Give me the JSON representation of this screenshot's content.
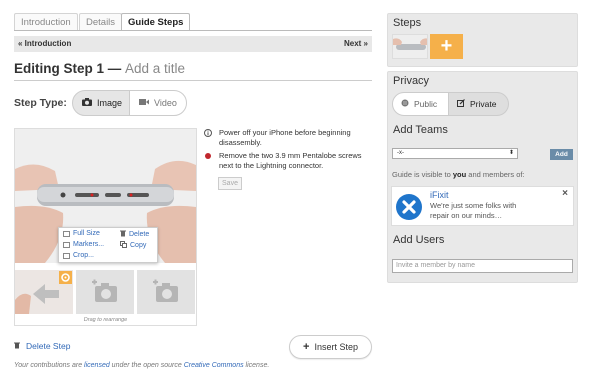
{
  "tabs": [
    {
      "label": "Introduction",
      "active": false
    },
    {
      "label": "Details",
      "active": false
    },
    {
      "label": "Guide Steps",
      "active": true
    }
  ],
  "nav": {
    "prev": "« Introduction",
    "next": "Next »"
  },
  "heading": {
    "prefix": "Editing Step 1 —",
    "placeholder": "Add a title"
  },
  "step_type": {
    "label": "Step Type:",
    "options": [
      {
        "label": "Image",
        "icon": "camera-icon",
        "selected": true
      },
      {
        "label": "Video",
        "icon": "video-icon",
        "selected": false
      }
    ]
  },
  "image_menu": {
    "full_size": "Full Size",
    "delete": "Delete",
    "markers": "Markers...",
    "copy": "Copy",
    "crop": "Crop..."
  },
  "drag_hint": "Drag to rearrange",
  "bullets": [
    {
      "color": "#555555",
      "icon": "info-icon",
      "text": "Power off your iPhone before beginning disassembly."
    },
    {
      "color": "#c0272d",
      "icon": "red-bullet-icon",
      "text": "Remove the two 3.9 mm Pentalobe screws next to the Lightning connector."
    }
  ],
  "save_label": "Save",
  "delete_step": "Delete Step",
  "insert_step": "Insert Step",
  "license": {
    "pre": "Your contributions are ",
    "link1": "licensed",
    "mid": " under the open source ",
    "link2": "Creative Commons",
    "post": " license."
  },
  "sidebar": {
    "steps_title": "Steps",
    "add_step_symbol": "+",
    "privacy_title": "Privacy",
    "privacy_options": [
      {
        "label": "Public",
        "icon": "globe-icon",
        "selected": false
      },
      {
        "label": "Private",
        "icon": "pencil-square-icon",
        "selected": true
      }
    ],
    "teams_title": "Add Teams",
    "team_select": "-x-",
    "add_button": "Add",
    "visible_pre": "Guide is visible to ",
    "visible_you": "you",
    "visible_post": " and members of:",
    "team": {
      "name": "iFixit",
      "description": "We're just some folks with repair on our minds…",
      "remove": "×"
    },
    "users_title": "Add Users",
    "invite_placeholder": "Invite a member by name"
  },
  "colors": {
    "accent_orange": "#f5b04a",
    "link_blue": "#336ab8",
    "ifixit_blue": "#1f75cb"
  }
}
